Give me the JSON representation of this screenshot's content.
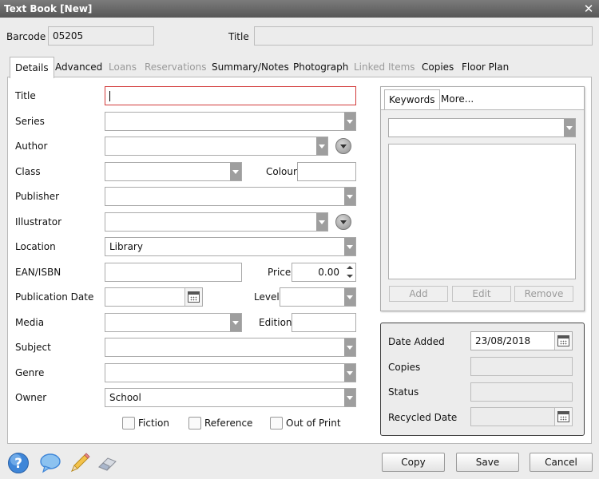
{
  "window": {
    "title": "Text Book [New]"
  },
  "header": {
    "barcode_label": "Barcode",
    "barcode_value": "05205",
    "title_label": "Title",
    "title_value": ""
  },
  "tabs": [
    {
      "label": "Details",
      "state": "active"
    },
    {
      "label": "Advanced",
      "state": "enabled"
    },
    {
      "label": "Loans",
      "state": "disabled"
    },
    {
      "label": "Reservations",
      "state": "disabled"
    },
    {
      "label": "Summary/Notes",
      "state": "enabled"
    },
    {
      "label": "Photograph",
      "state": "enabled"
    },
    {
      "label": "Linked Items",
      "state": "disabled"
    },
    {
      "label": "Copies",
      "state": "enabled"
    },
    {
      "label": "Floor Plan",
      "state": "enabled"
    }
  ],
  "form": {
    "title": {
      "label": "Title",
      "value": ""
    },
    "series": {
      "label": "Series",
      "value": ""
    },
    "author": {
      "label": "Author",
      "value": ""
    },
    "class": {
      "label": "Class",
      "value": ""
    },
    "colour": {
      "label": "Colour",
      "value": ""
    },
    "publisher": {
      "label": "Publisher",
      "value": ""
    },
    "illustrator": {
      "label": "Illustrator",
      "value": ""
    },
    "location": {
      "label": "Location",
      "value": "Library"
    },
    "ean": {
      "label": "EAN/ISBN",
      "value": ""
    },
    "price": {
      "label": "Price",
      "value": "0.00"
    },
    "publication_date": {
      "label": "Publication Date",
      "value": ""
    },
    "level": {
      "label": "Level",
      "value": ""
    },
    "media": {
      "label": "Media",
      "value": ""
    },
    "edition": {
      "label": "Edition",
      "value": ""
    },
    "subject": {
      "label": "Subject",
      "value": ""
    },
    "genre": {
      "label": "Genre",
      "value": ""
    },
    "owner": {
      "label": "Owner",
      "value": "School"
    },
    "fiction": {
      "label": "Fiction",
      "checked": false
    },
    "reference": {
      "label": "Reference",
      "checked": false
    },
    "out_of_print": {
      "label": "Out of Print",
      "checked": false
    }
  },
  "keywords": {
    "tabs": [
      "Keywords",
      "More..."
    ],
    "selected": "",
    "add_label": "Add",
    "edit_label": "Edit",
    "remove_label": "Remove"
  },
  "info": {
    "date_added_label": "Date Added",
    "date_added_value": "23/08/2018",
    "copies_label": "Copies",
    "copies_value": "",
    "status_label": "Status",
    "status_value": "",
    "recycled_label": "Recycled Date",
    "recycled_value": ""
  },
  "footer": {
    "icons": [
      "help-icon",
      "comment-icon",
      "pencil-icon",
      "eraser-icon"
    ],
    "copy_label": "Copy",
    "save_label": "Save",
    "cancel_label": "Cancel"
  },
  "colors": {
    "accent_focus": "#d23a3a",
    "titlebar": "#666666",
    "dropdown_button": "#9e9e9e"
  }
}
